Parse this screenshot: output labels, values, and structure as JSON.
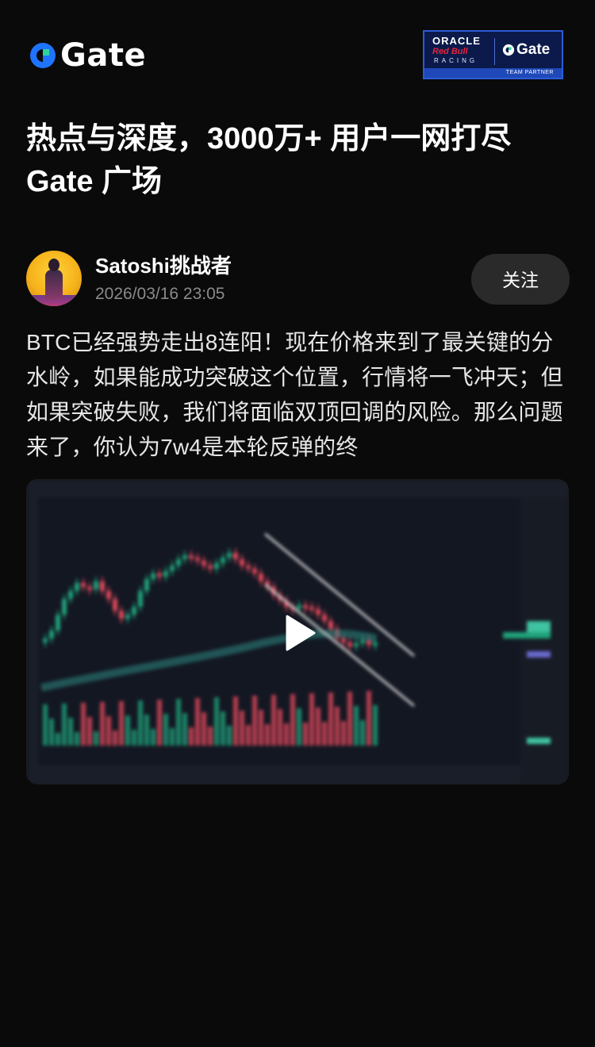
{
  "brand": {
    "name": "Gate",
    "accent_color": "#1e74ff"
  },
  "partner_badge": {
    "oracle": "ORACLE",
    "redbull": "Red Bull",
    "racing": "RACING",
    "gate": "Gate",
    "team_partner": "TEAM PARTNER"
  },
  "headline": {
    "line1": "热点与深度，3000万+ 用户一网打尽",
    "line2": "Gate 广场"
  },
  "post": {
    "author": "Satoshi挑战者",
    "timestamp": "2026/03/16 23:05",
    "follow_label": "关注",
    "text": "BTC已经强势走出8连阳！现在价格来到了最关键的分水岭，如果能成功突破这个位置，行情将一飞冲天；但如果突破失败，我们将面临双顶回调的风险。那么问题来了，你认为7w4是本轮反弹的终",
    "media_type": "video",
    "play_icon": "play-icon"
  },
  "colors": {
    "background": "#0a0a0a",
    "up_candle": "#1fa37a",
    "down_candle": "#e0485b",
    "follow_bg": "#2a2a2a"
  }
}
